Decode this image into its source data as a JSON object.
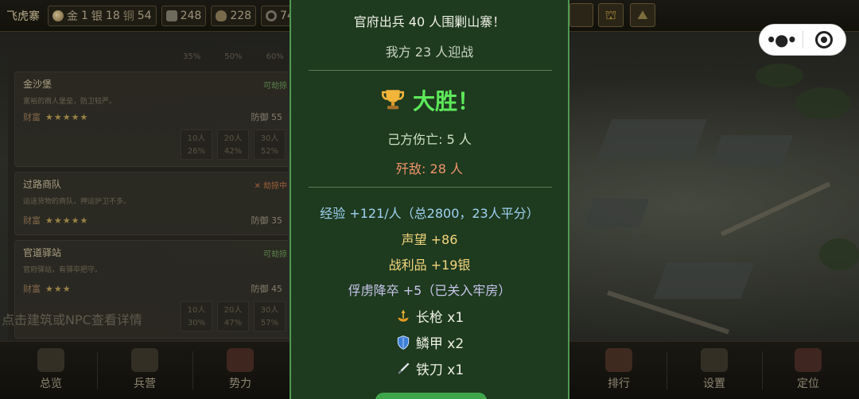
{
  "topbar": {
    "fort_name": "飞虎寨",
    "gold_label": "金",
    "gold_value": "1",
    "silver_label": "银",
    "silver_value": "18",
    "copper_label": "铜",
    "copper_value": "54",
    "stone_value": "248",
    "grain_value": "228",
    "ring_value": "74"
  },
  "targets": [
    {
      "name": "金沙堡",
      "status": "可劫掠",
      "desc": "富裕的商人堡垒，防卫较严。",
      "wealth_label": "财富",
      "stars": "★★★★★",
      "defense": "防御 55",
      "odds": [
        {
          "men": "10人",
          "rate": "26%"
        },
        {
          "men": "20人",
          "rate": "42%"
        },
        {
          "men": "30人",
          "rate": "52%"
        }
      ]
    },
    {
      "name": "过路商队",
      "status": "✕ 劫掠中",
      "desc": "运送货物的商队，押运护卫不多。",
      "wealth_label": "财富",
      "stars": "★★★★★",
      "defense": "防御 35"
    },
    {
      "name": "官道驿站",
      "status": "可劫掠",
      "desc": "官府驿站，有驿卒把守。",
      "wealth_label": "财富",
      "stars": "★★★",
      "defense": "防御 45",
      "odds": [
        {
          "men": "10人",
          "rate": "30%"
        },
        {
          "men": "20人",
          "rate": "47%"
        },
        {
          "men": "30人",
          "rate": "57%"
        }
      ]
    }
  ],
  "peek_row": [
    "35%",
    "50%",
    "60%"
  ],
  "hint": "点击建筑或NPC查看详情",
  "nav": [
    {
      "label": "总览"
    },
    {
      "label": "兵营"
    },
    {
      "label": "势力"
    },
    {
      "label": "排行"
    },
    {
      "label": "设置"
    },
    {
      "label": "定位"
    }
  ],
  "report": {
    "line1": "官府出兵 40 人围剿山寨！",
    "line2": "我方 23 人迎战",
    "verdict": "大胜！",
    "own_losses": "己方伤亡: 5 人",
    "enemy_kills": "歼敌: 28 人",
    "exp": "经验 +121/人（总2800，23人平分）",
    "prestige": "声望 +86",
    "spoils": "战利品 +19银",
    "captives": "俘虏降卒 +5（已关入牢房）",
    "loot": [
      {
        "icon": "spear-icon",
        "text": "长枪 x1"
      },
      {
        "icon": "shield-icon",
        "text": "鳞甲 x2"
      },
      {
        "icon": "knife-icon",
        "text": "铁刀 x1"
      }
    ]
  },
  "colors": {
    "panel_bg": "#1e3a1f",
    "panel_border": "#4f9a52",
    "victory": "#5ee85a",
    "enemy_kills": "#f2946b",
    "exp": "#9fd3f2",
    "prestige": "#f4d77e",
    "captives": "#c9c6ec"
  }
}
